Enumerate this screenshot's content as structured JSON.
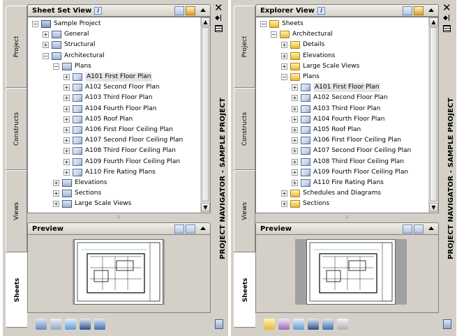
{
  "left": {
    "header": {
      "title": "Sheet Set View",
      "info": "i"
    },
    "tabs": [
      "Project",
      "Constructs",
      "Views",
      "Sheets"
    ],
    "tree": [
      {
        "depth": 0,
        "exp": "-",
        "icon": "set",
        "label": "Sample Project"
      },
      {
        "depth": 1,
        "exp": "+",
        "icon": "subset",
        "label": "General"
      },
      {
        "depth": 1,
        "exp": "+",
        "icon": "subset",
        "label": "Structural"
      },
      {
        "depth": 1,
        "exp": "-",
        "icon": "subset",
        "label": "Architectural"
      },
      {
        "depth": 2,
        "exp": "-",
        "icon": "subset",
        "label": "Plans"
      },
      {
        "depth": 3,
        "exp": "+",
        "icon": "sheet",
        "label": "A101 First Floor Plan",
        "selected": true
      },
      {
        "depth": 3,
        "exp": "+",
        "icon": "sheet",
        "label": "A102 Second Floor Plan"
      },
      {
        "depth": 3,
        "exp": "+",
        "icon": "sheet",
        "label": "A103 Third Floor Plan"
      },
      {
        "depth": 3,
        "exp": "+",
        "icon": "sheet",
        "label": "A104 Fourth Floor Plan"
      },
      {
        "depth": 3,
        "exp": "+",
        "icon": "sheet",
        "label": "A105 Roof Plan"
      },
      {
        "depth": 3,
        "exp": "+",
        "icon": "sheet",
        "label": "A106 First Floor Ceiling Plan"
      },
      {
        "depth": 3,
        "exp": "+",
        "icon": "sheet",
        "label": "A107 Second Floor Ceiling Plan"
      },
      {
        "depth": 3,
        "exp": "+",
        "icon": "sheet",
        "label": "A108 Third Floor Ceiling Plan"
      },
      {
        "depth": 3,
        "exp": "+",
        "icon": "sheet",
        "label": "A109 Fourth Floor Ceiling Plan"
      },
      {
        "depth": 3,
        "exp": "+",
        "icon": "sheet",
        "label": "A110 Fire Rating Plans"
      },
      {
        "depth": 2,
        "exp": "+",
        "icon": "subset",
        "label": "Elevations"
      },
      {
        "depth": 2,
        "exp": "+",
        "icon": "subset",
        "label": "Sections"
      },
      {
        "depth": 2,
        "exp": "+",
        "icon": "subset",
        "label": "Large Scale Views"
      }
    ],
    "preview_title": "Preview",
    "side_title": "PROJECT NAVIGATOR - SAMPLE PROJECT",
    "toolbar_icons": [
      "sheet-set-icon",
      "publish-icon",
      "tools-icon",
      "layout-icon",
      "refresh-icon"
    ]
  },
  "right": {
    "header": {
      "title": "Explorer View",
      "info": "i"
    },
    "tabs": [
      "Project",
      "Constructs",
      "Views",
      "Sheets"
    ],
    "tree": [
      {
        "depth": 0,
        "exp": "-",
        "icon": "folder",
        "label": "Sheets"
      },
      {
        "depth": 1,
        "exp": "-",
        "icon": "folder",
        "label": "Architectural"
      },
      {
        "depth": 2,
        "exp": "+",
        "icon": "folder",
        "label": "Details"
      },
      {
        "depth": 2,
        "exp": "+",
        "icon": "folder",
        "label": "Elevations"
      },
      {
        "depth": 2,
        "exp": "+",
        "icon": "folder",
        "label": "Large Scale Views"
      },
      {
        "depth": 2,
        "exp": "-",
        "icon": "folder",
        "label": "Plans"
      },
      {
        "depth": 3,
        "exp": "+",
        "icon": "sheet",
        "label": "A101 First Floor Plan",
        "selected": true
      },
      {
        "depth": 3,
        "exp": "+",
        "icon": "sheet",
        "label": "A102 Second Floor Plan"
      },
      {
        "depth": 3,
        "exp": "+",
        "icon": "sheet",
        "label": "A103 Third Floor Plan"
      },
      {
        "depth": 3,
        "exp": "+",
        "icon": "sheet",
        "label": "A104 Fourth Floor Plan"
      },
      {
        "depth": 3,
        "exp": "+",
        "icon": "sheet",
        "label": "A105 Roof Plan"
      },
      {
        "depth": 3,
        "exp": "+",
        "icon": "sheet",
        "label": "A106 First Floor Ceiling Plan"
      },
      {
        "depth": 3,
        "exp": "+",
        "icon": "sheet",
        "label": "A107 Second Floor Ceiling Plan"
      },
      {
        "depth": 3,
        "exp": "+",
        "icon": "sheet",
        "label": "A108 Third Floor Ceiling Plan"
      },
      {
        "depth": 3,
        "exp": "+",
        "icon": "sheet",
        "label": "A109 Fourth Floor Ceiling Plan"
      },
      {
        "depth": 3,
        "exp": "+",
        "icon": "sheet",
        "label": "A110 Fire Rating Plans"
      },
      {
        "depth": 2,
        "exp": "+",
        "icon": "folder",
        "label": "Schedules and Diagrams"
      },
      {
        "depth": 2,
        "exp": "+",
        "icon": "folder",
        "label": "Sections"
      }
    ],
    "preview_title": "Preview",
    "side_title": "PROJECT NAVIGATOR - SAMPLE PROJECT",
    "toolbar_icons": [
      "new-sheet-icon",
      "regenerate-icon",
      "tools-icon",
      "layout-icon",
      "refresh-icon",
      "copy-icon"
    ]
  }
}
